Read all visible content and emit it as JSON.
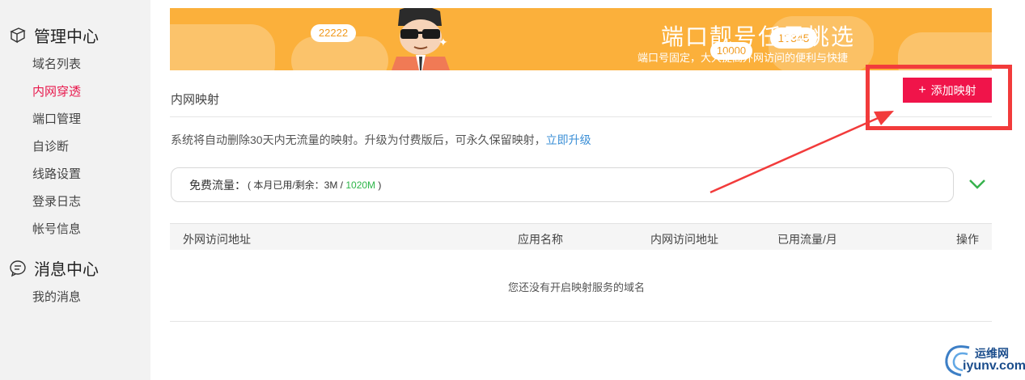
{
  "sidebar": {
    "section1_title": "管理中心",
    "items": [
      {
        "label": "域名列表",
        "active": false
      },
      {
        "label": "内网穿透",
        "active": true
      },
      {
        "label": "端口管理",
        "active": false
      },
      {
        "label": "自诊断",
        "active": false
      },
      {
        "label": "线路设置",
        "active": false
      },
      {
        "label": "登录日志",
        "active": false
      },
      {
        "label": "帐号信息",
        "active": false
      }
    ],
    "section2_title": "消息中心",
    "items2": [
      {
        "label": "我的消息"
      }
    ]
  },
  "banner": {
    "title": "端口靓号任君挑选",
    "subtitle": "端口号固定，大大提高外网访问的便利与快捷",
    "badges": [
      "22222",
      "10000",
      "12345"
    ]
  },
  "page": {
    "title": "内网映射",
    "add_button": "添加映射",
    "add_button_icon": "plus-icon",
    "notice": "系统将自动删除30天内无流量的映射。升级为付费版后，可永久保留映射，",
    "notice_link": "立即升级"
  },
  "traffic": {
    "label": "免费流量：",
    "detail_prefix": "( 本月已用/剩余：3M / ",
    "remaining": "1020M",
    "detail_suffix": " )",
    "expand_icon": "chevron-down-icon"
  },
  "table": {
    "columns": [
      "外网访问地址",
      "应用名称",
      "内网访问地址",
      "已用流量/月",
      "操作"
    ],
    "empty_text": "您还没有开启映射服务的域名"
  },
  "watermark": {
    "cn": "运维网",
    "en": "iyunv.com"
  },
  "colors": {
    "accent": "#f0144a",
    "banner": "#fbb03b",
    "link": "#3b8fd6",
    "green": "#2cb548",
    "annotation": "#f23b3b"
  }
}
